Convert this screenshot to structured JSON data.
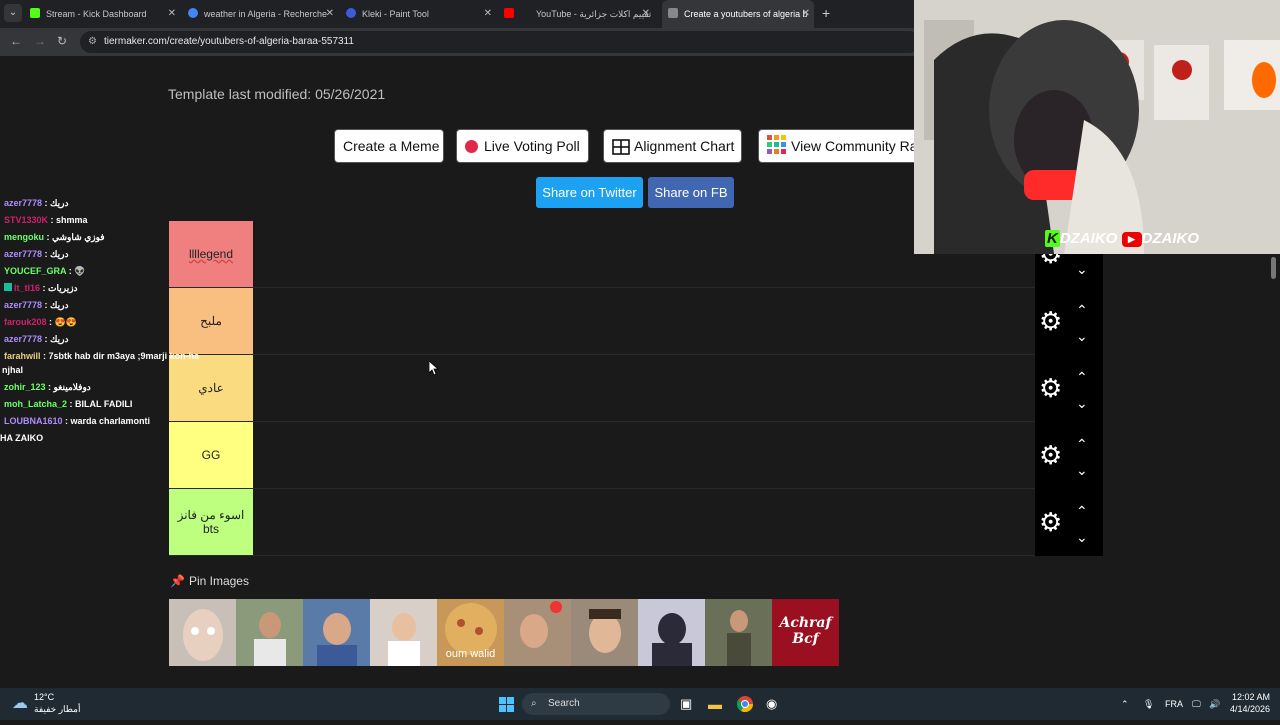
{
  "tabs": [
    {
      "title": "Stream - Kick Dashboard",
      "color": "#53fc18"
    },
    {
      "title": "weather in Algeria - Recherche",
      "color": "#4285f4"
    },
    {
      "title": "Kleki - Paint Tool",
      "color": "#3b5bdb"
    },
    {
      "title": "YouTube - تقييم اكلات جزائرية",
      "color": "#ff0000"
    },
    {
      "title": "Create a youtubers of algeria b",
      "color": "#888888"
    }
  ],
  "address": {
    "url": "tiermaker.com/create/youtubers-of-algeria-baraa-557311"
  },
  "page": {
    "modified": "Template last modified: 05/26/2021",
    "buttons": {
      "meme": "Create a Meme",
      "poll": "Live Voting Poll",
      "alignment": "Alignment Chart",
      "community": "View Community Ra"
    },
    "share_twitter": "Share on Twitter",
    "share_fb": "Share on FB",
    "tiers": [
      {
        "label": "llllegend",
        "color": "#f08080"
      },
      {
        "label": "ملبح",
        "color": "#f9bf80"
      },
      {
        "label": "عادي",
        "color": "#fbdb80"
      },
      {
        "label": "GG",
        "color": "#ffff80"
      },
      {
        "label": "اسوء من فانز bts",
        "color": "#bfff80"
      }
    ],
    "pin_title": "Pin Images",
    "thumbs": [
      {
        "color": "#c8c0b8",
        "caption": ""
      },
      {
        "color": "#8a9a7a",
        "caption": ""
      },
      {
        "color": "#5a7aa8",
        "caption": ""
      },
      {
        "color": "#d8d0c8",
        "caption": ""
      },
      {
        "color": "#c89858",
        "caption": "oum walid"
      },
      {
        "color": "#a89078",
        "caption": ""
      },
      {
        "color": "#9a8a7a",
        "caption": ""
      },
      {
        "color": "#c8c8d8",
        "caption": ""
      },
      {
        "color": "#6a7058",
        "caption": ""
      },
      {
        "color": "#9a1020",
        "caption": "Achraf Bcf"
      }
    ]
  },
  "chat": [
    {
      "user": "azer7778",
      "color": "#b08cff",
      "msg": " : دريك"
    },
    {
      "user": "STV1330K",
      "color": "#d0206c",
      "msg": " : shmma"
    },
    {
      "user": "mengoku",
      "color": "#6cff6c",
      "msg": " : فوزي شاوشي"
    },
    {
      "user": "azer7778",
      "color": "#b08cff",
      "msg": " : دريك"
    },
    {
      "user": "YOUCEF_GRA",
      "color": "#6cff6c",
      "msg": " : 👽"
    },
    {
      "user": "lt_tl16",
      "color": "#d0206c",
      "msg": " : دزيريات"
    },
    {
      "user": "azer7778",
      "color": "#b08cff",
      "msg": " : دريك"
    },
    {
      "user": "farouk208",
      "color": "#d0206c",
      "msg": " : 😍😍"
    },
    {
      "user": "azer7778",
      "color": "#b08cff",
      "msg": " : دريك"
    },
    {
      "user": "farahwill",
      "color": "#e8d080",
      "msg": " : 7sbtk hab dir m3aya ;9marji kon-ha"
    },
    {
      "user": "",
      "color": "#ffffff",
      "msg": "njhal"
    },
    {
      "user": "zohir_123",
      "color": "#6cff6c",
      "msg": " : دوفلامينغو"
    },
    {
      "user": "moh_Latcha_2",
      "color": "#6cff6c",
      "msg": " : BILAL FADILI"
    },
    {
      "user": "LOUBNA1610",
      "color": "#b08cff",
      "msg": " : warda charlamonti"
    },
    {
      "user": "",
      "color": "#ffffff",
      "msg": "HA ZAIKO"
    }
  ],
  "overlay": {
    "kick": "DZAIKO",
    "youtube": "DZAIKO"
  },
  "taskbar": {
    "temp": "12°C",
    "weather": "أمطار خفيفة",
    "search": "Search",
    "lang": "FRA",
    "time": "12:02 AM",
    "date": "4/14/2026"
  }
}
